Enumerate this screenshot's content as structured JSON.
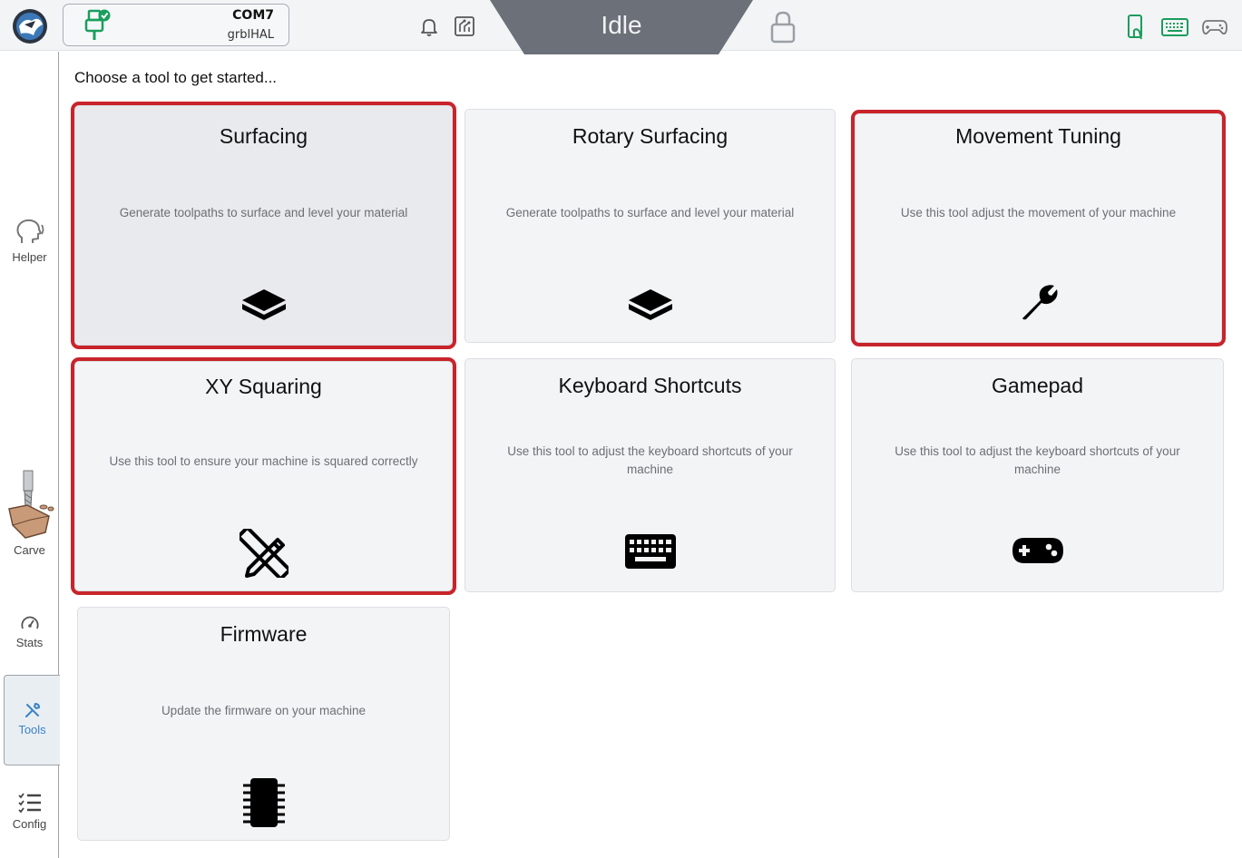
{
  "connection": {
    "port": "COM7",
    "firmware": "grblHAL"
  },
  "machine_state": "Idle",
  "sidebar": {
    "items": [
      {
        "label": "Helper",
        "icon": "chat-head-icon"
      },
      {
        "label": "Carve",
        "icon": "carve-icon"
      },
      {
        "label": "Stats",
        "icon": "gauge-icon"
      },
      {
        "label": "Tools",
        "icon": "tools-icon"
      },
      {
        "label": "Config",
        "icon": "checklist-icon"
      }
    ]
  },
  "main": {
    "prompt": "Choose a tool to get started...",
    "cards": [
      {
        "title": "Surfacing",
        "description": "Generate toolpaths to surface and level your material",
        "icon": "layer-icon"
      },
      {
        "title": "Rotary Surfacing",
        "description": "Generate toolpaths to surface and level your material",
        "icon": "layer-icon"
      },
      {
        "title": "Movement Tuning",
        "description": "Use this tool adjust the movement of your machine",
        "icon": "wrench-icon"
      },
      {
        "title": "XY Squaring",
        "description": "Use this tool to ensure your machine is squared correctly",
        "icon": "ruler-pencil-icon"
      },
      {
        "title": "Keyboard Shortcuts",
        "description": "Use this tool to adjust the keyboard shortcuts of your machine",
        "icon": "keyboard-icon"
      },
      {
        "title": "Gamepad",
        "description": "Use this tool to adjust the keyboard shortcuts of your machine",
        "icon": "gamepad-icon"
      },
      {
        "title": "Firmware",
        "description": "Update the firmware on your machine",
        "icon": "chip-icon"
      }
    ]
  },
  "colors": {
    "highlight": "#c8242c",
    "accent_green": "#1a9e5c",
    "state_banner": "#6b7079",
    "active_nav": "#3b82c4"
  }
}
